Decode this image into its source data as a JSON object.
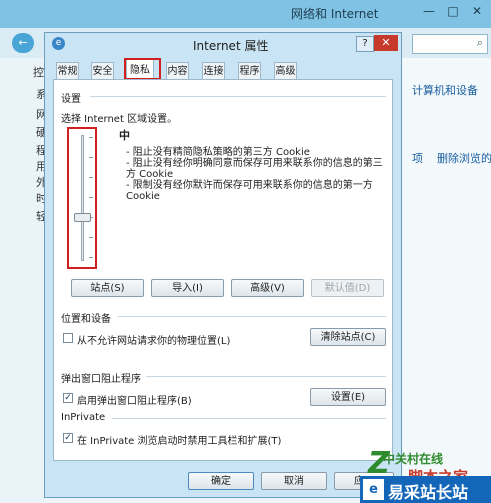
{
  "background": {
    "title": "网络和 Internet",
    "minimize": "—",
    "maximize": "□",
    "close": "✕",
    "nav_back": "←",
    "nav_forward": "→",
    "search_icon": "search-icon",
    "side_chars": [
      "控",
      "系",
      "网",
      "硬",
      "程",
      "用",
      "外",
      "时",
      "轻"
    ],
    "link_computers": "计算机和设备",
    "link_sep": "项",
    "link_delete": "删除浏览的历"
  },
  "dialog": {
    "title": "Internet 属性",
    "help": "?",
    "close": "✕",
    "tabs": [
      "常规",
      "安全",
      "隐私",
      "内容",
      "连接",
      "程序",
      "高级"
    ],
    "active_tab": "隐私",
    "settings_label": "设置",
    "zone_label": "选择 Internet 区域设置。",
    "level": "中",
    "descriptions": [
      "- 阻止没有精简隐私策略的第三方 Cookie",
      "- 阻止没有经你明确同意而保存可用来联系你的信息的第三方 Cookie",
      "- 限制没有经你默许而保存可用来联系你的信息的第一方 Cookie"
    ],
    "slider_level": 0.33,
    "buttons": {
      "sites": "站点(S)",
      "import": "导入(I)",
      "advanced": "高级(V)",
      "default": "默认值(D)"
    },
    "location": {
      "label": "位置和设备",
      "checkbox": "从不允许网站请求你的物理位置(L)",
      "checked": false,
      "clear_button": "清除站点(C)"
    },
    "popup": {
      "label": "弹出窗口阻止程序",
      "checkbox": "启用弹出窗口阻止程序(B)",
      "checked": true,
      "settings_button": "设置(E)"
    },
    "inprivate": {
      "label": "InPrivate",
      "checkbox": "在 InPrivate 浏览启动时禁用工具栏和扩展(T)",
      "checked": true
    },
    "ok": "确定",
    "cancel": "取消",
    "apply": "应用"
  },
  "watermark": {
    "z": "Z",
    "green": "中关村在线",
    "red": "脚本之家",
    "blue_icon": "e",
    "blue_text": "易采站长站"
  },
  "colors": {
    "highlight": "#cf1f1f",
    "titlebar": "#7fc2e3",
    "dialog": "#c9e4f4"
  }
}
